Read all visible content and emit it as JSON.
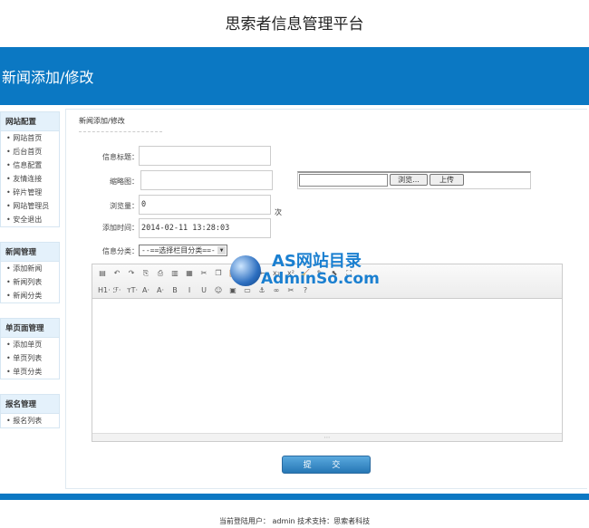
{
  "header": {
    "title": "思索者信息管理平台",
    "page_heading": "新闻添加/修改"
  },
  "sidebar": [
    {
      "title": "网站配置",
      "items": [
        "网站首页",
        "后台首页",
        "信息配置",
        "友情连接",
        "碎片管理",
        "网站管理员",
        "安全退出"
      ]
    },
    {
      "title": "新闻管理",
      "items": [
        "添加新闻",
        "新闻列表",
        "新闻分类"
      ]
    },
    {
      "title": "单页面管理",
      "items": [
        "添加单页",
        "单页列表",
        "单页分类"
      ]
    },
    {
      "title": "报名管理",
      "items": [
        "报名列表"
      ]
    }
  ],
  "main": {
    "breadcrumb": "新闻添加/修改",
    "form": {
      "title_label": "信息标题：",
      "title_value": "",
      "thumb_label": "缩略图：",
      "thumb_value": "",
      "browse_label": "浏览...",
      "upload_label": "上传",
      "views_label": "浏览量：",
      "views_value": "0",
      "views_unit": "次",
      "time_label": "添加时间：",
      "time_value": "2014-02-11 13:28:03",
      "category_label": "信息分类：",
      "category_value": "--==选择栏目分类==-"
    },
    "toolbar": {
      "row1": [
        "source",
        "undo",
        "redo",
        "preview",
        "print",
        "template",
        "paste-text",
        "cut",
        "copy",
        "paste",
        "indent",
        "outdent",
        "subscript",
        "superscript",
        "clear-format",
        "format-painter",
        "select-all",
        "fullscreen"
      ],
      "row1_labels": [
        "▤",
        "↶",
        "↷",
        "⎘",
        "⎙",
        "▥",
        "▦",
        "✂",
        "❐",
        "📋",
        "⇥",
        "⇤",
        "x₂",
        "x²",
        "🧹",
        "✎",
        "⬉",
        "⛶"
      ],
      "row2_labels": [
        "H1·",
        "ℱ·",
        "тT·",
        "A·",
        "A·",
        "B",
        "I",
        "U",
        "☺",
        "▣",
        "▭",
        "⚓",
        "∞",
        "✂",
        "?"
      ],
      "row2": [
        "heading",
        "font-family",
        "font-size",
        "font-color",
        "highlight",
        "bold",
        "italic",
        "underline",
        "emoticon",
        "image",
        "hr",
        "anchor",
        "link",
        "unlink",
        "help"
      ]
    },
    "submit_label": "提  交"
  },
  "footer": {
    "text": "当前登陆用户： admin  技术支持：思索者科技"
  },
  "watermark": {
    "line1": "AS网站目录",
    "line2": "AdminSo.com"
  },
  "colors": {
    "brand_blue": "#0b78c3",
    "sidebar_header": "#e4f1fb"
  }
}
